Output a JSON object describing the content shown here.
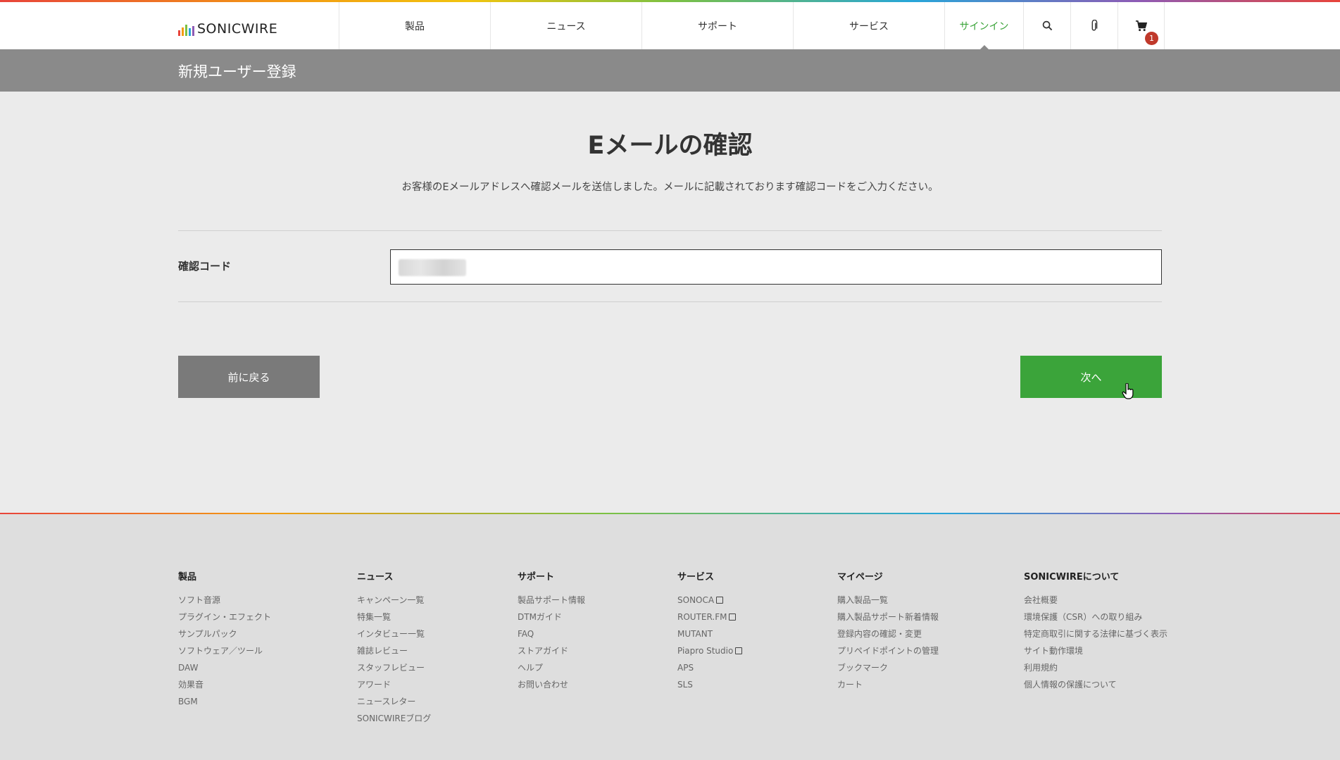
{
  "header": {
    "logo_text": "SONICWIRE",
    "nav": {
      "products": "製品",
      "news": "ニュース",
      "support": "サポート",
      "services": "サービス",
      "signin": "サインイン"
    },
    "cart_count": "1",
    "accent_color": "#3ba43a"
  },
  "page": {
    "title": "新規ユーザー登録",
    "heading": "Eメールの確認",
    "description": "お客様のEメールアドレスへ確認メールを送信しました。メールに記載されております確認コードをご入力ください。"
  },
  "form": {
    "code_label": "確認コード",
    "back_label": "前に戻る",
    "next_label": "次へ"
  },
  "footer": {
    "columns": [
      {
        "title": "製品",
        "items": [
          "ソフト音源",
          "プラグイン・エフェクト",
          "サンプルパック",
          "ソフトウェア／ツール",
          "DAW",
          "効果音",
          "BGM"
        ]
      },
      {
        "title": "ニュース",
        "items": [
          "キャンペーン一覧",
          "特集一覧",
          "インタビュー一覧",
          "雑誌レビュー",
          "スタッフレビュー",
          "アワード",
          "ニュースレター",
          "SONICWIREブログ"
        ]
      },
      {
        "title": "サポート",
        "items": [
          "製品サポート情報",
          "DTMガイド",
          "FAQ",
          "ストアガイド",
          "ヘルプ",
          "お問い合わせ"
        ]
      },
      {
        "title": "サービス",
        "items": [
          "SONOCA",
          "ROUTER.FM",
          "MUTANT",
          "Piapro Studio",
          "APS",
          "SLS"
        ]
      },
      {
        "title": "マイページ",
        "items": [
          "購入製品一覧",
          "購入製品サポート新着情報",
          "登録内容の確認・変更",
          "プリペイドポイントの管理",
          "ブックマーク",
          "カート"
        ]
      },
      {
        "title": "SONICWIREについて",
        "items": [
          "会社概要",
          "環境保護（CSR）への取り組み",
          "特定商取引に関する法律に基づく表示",
          "サイト動作環境",
          "利用規約",
          "個人情報の保護について"
        ]
      }
    ]
  }
}
